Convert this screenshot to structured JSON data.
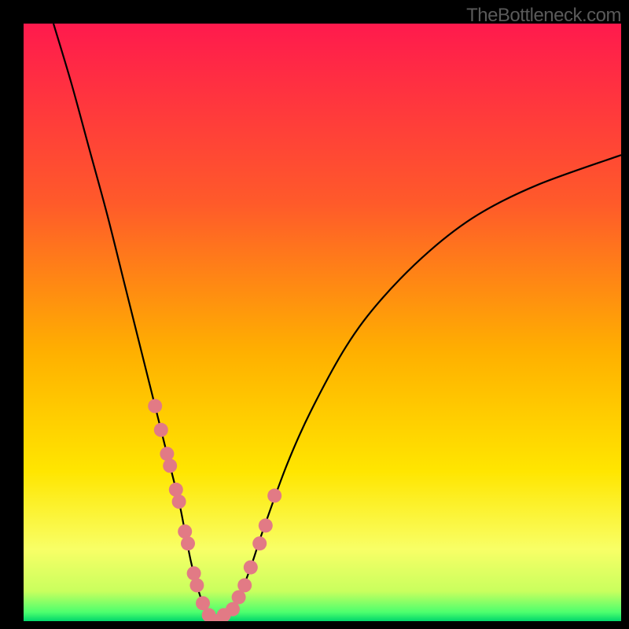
{
  "watermark": "TheBottleneck.com",
  "chart_data": {
    "type": "line",
    "title": "",
    "xlabel": "",
    "ylabel": "",
    "xlim": [
      0,
      100
    ],
    "ylim": [
      0,
      100
    ],
    "gradient_stops": [
      {
        "offset": 0,
        "color": "#ff1a4d"
      },
      {
        "offset": 0.3,
        "color": "#ff5a2a"
      },
      {
        "offset": 0.55,
        "color": "#ffb000"
      },
      {
        "offset": 0.75,
        "color": "#ffe600"
      },
      {
        "offset": 0.88,
        "color": "#f8ff66"
      },
      {
        "offset": 0.95,
        "color": "#c9ff5e"
      },
      {
        "offset": 0.985,
        "color": "#4dff6e"
      },
      {
        "offset": 1.0,
        "color": "#00d66b"
      }
    ],
    "series": [
      {
        "name": "bottleneck-curve",
        "x": [
          5,
          8,
          11,
          14,
          17,
          20,
          22,
          24,
          26,
          27,
          28,
          29,
          30,
          31,
          32,
          33,
          34,
          36,
          38,
          40,
          44,
          48,
          54,
          60,
          68,
          76,
          86,
          100
        ],
        "y": [
          100,
          90,
          79,
          68,
          56,
          44,
          36,
          28,
          20,
          15,
          10,
          6,
          3,
          1,
          0,
          0,
          1,
          4,
          9,
          15,
          26,
          35,
          46,
          54,
          62,
          68,
          73,
          78
        ]
      }
    ],
    "scatter_points": {
      "name": "highlight-points",
      "color": "#e27a85",
      "x": [
        22.0,
        23.0,
        24.0,
        24.5,
        25.5,
        26.0,
        27.0,
        27.5,
        28.5,
        29.0,
        30.0,
        31.0,
        32.0,
        33.0,
        33.5,
        35.0,
        36.0,
        37.0,
        38.0,
        39.5,
        40.5,
        42.0
      ],
      "y": [
        36,
        32,
        28,
        26,
        22,
        20,
        15,
        13,
        8,
        6,
        3,
        1,
        0,
        0,
        1,
        2,
        4,
        6,
        9,
        13,
        16,
        21
      ]
    }
  }
}
